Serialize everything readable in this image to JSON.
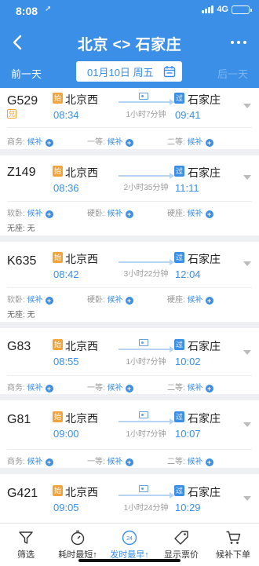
{
  "status": {
    "time": "8:08",
    "location_arrow": "➚",
    "network": "4G"
  },
  "nav": {
    "title": "北京 <> 石家庄",
    "prev_day": "前一天",
    "next_day": "后一天",
    "date": "01月10日 周五"
  },
  "colors": {
    "accent": "#3c8fe6",
    "origin_tag": "#f2a33a",
    "pass_tag": "#3c8fe6"
  },
  "trains": [
    {
      "no": "G529",
      "badge": "兑",
      "dep_tag": "始",
      "dep_station": "北京西",
      "dep_time": "08:34",
      "duration": "1小时7分钟",
      "arr_tag": "过",
      "arr_station": "石家庄",
      "arr_time": "09:41",
      "seats": [
        {
          "label": "商务:",
          "status": "候补"
        },
        {
          "label": "一等:",
          "status": "候补"
        },
        {
          "label": "二等:",
          "status": "候补"
        }
      ]
    },
    {
      "no": "Z149",
      "dep_tag": "始",
      "dep_station": "北京西",
      "dep_time": "08:36",
      "duration": "2小时35分钟",
      "arr_tag": "过",
      "arr_station": "石家庄",
      "arr_time": "11:11",
      "seats": [
        {
          "label": "软卧:",
          "status": "候补"
        },
        {
          "label": "硬卧:",
          "status": "候补"
        },
        {
          "label": "硬座:",
          "status": "候补"
        }
      ],
      "extra": "无座: 无"
    },
    {
      "no": "K635",
      "dep_tag": "始",
      "dep_station": "北京西",
      "dep_time": "08:42",
      "duration": "3小时22分钟",
      "arr_tag": "过",
      "arr_station": "石家庄",
      "arr_time": "12:04",
      "seats": [
        {
          "label": "软卧:",
          "status": "候补"
        },
        {
          "label": "硬卧:",
          "status": "候补"
        },
        {
          "label": "硬座:",
          "status": "候补"
        }
      ],
      "extra": "无座: 无"
    },
    {
      "no": "G83",
      "dep_tag": "始",
      "dep_station": "北京西",
      "dep_time": "08:55",
      "duration": "1小时7分钟",
      "arr_tag": "过",
      "arr_station": "石家庄",
      "arr_time": "10:02",
      "seats": [
        {
          "label": "商务:",
          "status": "候补"
        },
        {
          "label": "一等:",
          "status": "候补"
        },
        {
          "label": "二等:",
          "status": "候补"
        }
      ]
    },
    {
      "no": "G81",
      "dep_tag": "始",
      "dep_station": "北京西",
      "dep_time": "09:00",
      "duration": "1小时7分钟",
      "arr_tag": "过",
      "arr_station": "石家庄",
      "arr_time": "10:07",
      "seats": [
        {
          "label": "商务:",
          "status": "候补"
        },
        {
          "label": "一等:",
          "status": "候补"
        },
        {
          "label": "二等:",
          "status": "候补"
        }
      ]
    },
    {
      "no": "G421",
      "dep_tag": "始",
      "dep_station": "北京西",
      "dep_time": "09:05",
      "duration": "1小时24分钟",
      "arr_tag": "过",
      "arr_station": "石家庄",
      "arr_time": "10:29",
      "seats": []
    }
  ],
  "tabs": [
    {
      "label": "筛选",
      "icon": "filter-icon"
    },
    {
      "label": "耗时最短↑",
      "icon": "timer-icon"
    },
    {
      "label": "发时最早↑",
      "icon": "clock-24-icon",
      "active": true
    },
    {
      "label": "显示票价",
      "icon": "price-tag-icon"
    },
    {
      "label": "候补下单",
      "icon": "cart-icon"
    }
  ]
}
